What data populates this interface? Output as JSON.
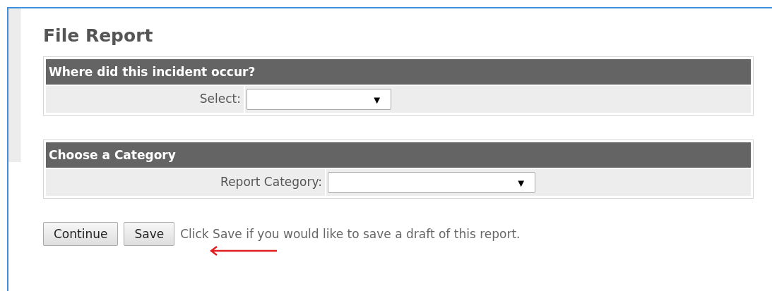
{
  "title": "File Report",
  "sections": [
    {
      "heading": "Where did this incident occur?",
      "field_label": "Select:",
      "dropdown_arrow": "▼"
    },
    {
      "heading": "Choose a Category",
      "field_label": "Report Category:",
      "dropdown_arrow": "▼"
    }
  ],
  "buttons": [
    "Continue",
    "Save"
  ],
  "hint": "Click Save if you would like to save a draft of this report."
}
